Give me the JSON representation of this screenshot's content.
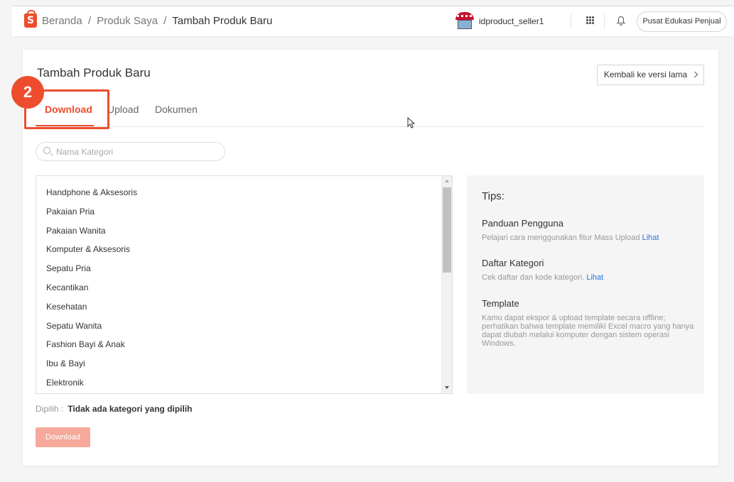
{
  "header": {
    "logo_letter": "S",
    "breadcrumb": [
      "Beranda",
      "Produk Saya",
      "Tambah Produk Baru"
    ],
    "breadcrumb_sep": "/",
    "username": "idproduct_seller1",
    "edu_button": "Pusat Edukasi Penjual",
    "icons": [
      "shop-avatar",
      "apps-grid-icon",
      "bell-icon"
    ]
  },
  "page": {
    "title": "Tambah Produk Baru",
    "back_button": "Kembali ke versi lama",
    "step_badge": "2",
    "tabs": [
      {
        "label": "Download",
        "active": true
      },
      {
        "label": "Upload",
        "active": false
      },
      {
        "label": "Dokumen",
        "active": false
      }
    ]
  },
  "search": {
    "placeholder": "Nama Kategori",
    "value": ""
  },
  "categories": [
    "Handphone & Aksesoris",
    "Pakaian Pria",
    "Pakaian Wanita",
    "Komputer & Aksesoris",
    "Sepatu Pria",
    "Kecantikan",
    "Kesehatan",
    "Sepatu Wanita",
    "Fashion Bayi & Anak",
    "Ibu & Bayi",
    "Elektronik"
  ],
  "selection": {
    "label": "Dipilih :",
    "value": "Tidak ada kategori yang dipilih"
  },
  "download_button": "Download",
  "tips": {
    "heading": "Tips:",
    "items": [
      {
        "title": "Panduan Pengguna",
        "desc": "Pelajari cara menggunakan fitur Mass Upload",
        "link": "Lihat"
      },
      {
        "title": "Daftar Kategori",
        "desc": "Cek daftar dan kode kategori.",
        "link": "Lihat"
      },
      {
        "title": "Template",
        "desc": "Kamu dapat ekspor & upload template secara offline; perhatikan bahwa template memiliki Excel macro yang hanya dapat diubah melalui komputer dengan sistem operasi Windows.",
        "link": ""
      }
    ]
  },
  "colors": {
    "brand": "#ee4d2d",
    "link": "#2673dd",
    "disabled_button": "#f6a99a"
  }
}
